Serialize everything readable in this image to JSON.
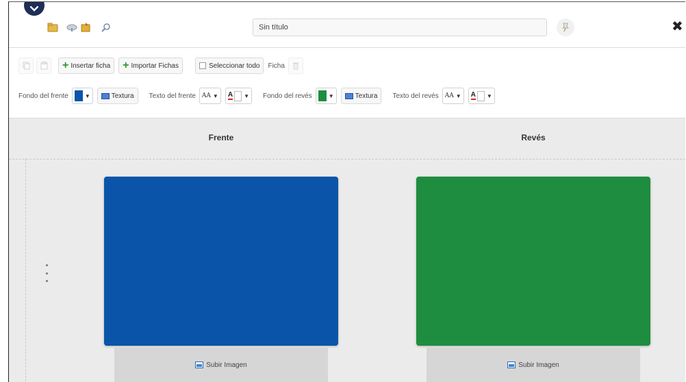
{
  "header": {
    "title_value": "Sin título"
  },
  "toolbar": {
    "insert_card_label": "Insertar ficha",
    "import_cards_label": "Importar Fichas",
    "select_all_label": "Seleccionar todo",
    "card_label": "Ficha"
  },
  "styling": {
    "front_bg_label": "Fondo del frente",
    "front_texture_label": "Textura",
    "front_text_label": "Texto del frente",
    "back_bg_label": "Fondo del revés",
    "back_texture_label": "Textura",
    "back_text_label": "Texto del revés",
    "font_size_glyph": "AA",
    "font_color_glyph": "A"
  },
  "columns": {
    "front_heading": "Frente",
    "back_heading": "Revés"
  },
  "cards": [
    {
      "front_color": "#0a55a9",
      "back_color": "#1f8d3f",
      "front_upload_label": "Subir Imagen",
      "back_upload_label": "Subir Imagen"
    }
  ],
  "colors": {
    "accent_dark": "#1d2f57",
    "front_default": "#0a55a9",
    "back_default": "#1f8d3f",
    "add_icon": "#2e9a2e"
  },
  "icons": {
    "collapse": "chevron-down-icon",
    "open": "folder-icon",
    "save": "save-icon",
    "search": "magnifier-icon",
    "pin": "pin-icon",
    "close": "close-icon"
  }
}
